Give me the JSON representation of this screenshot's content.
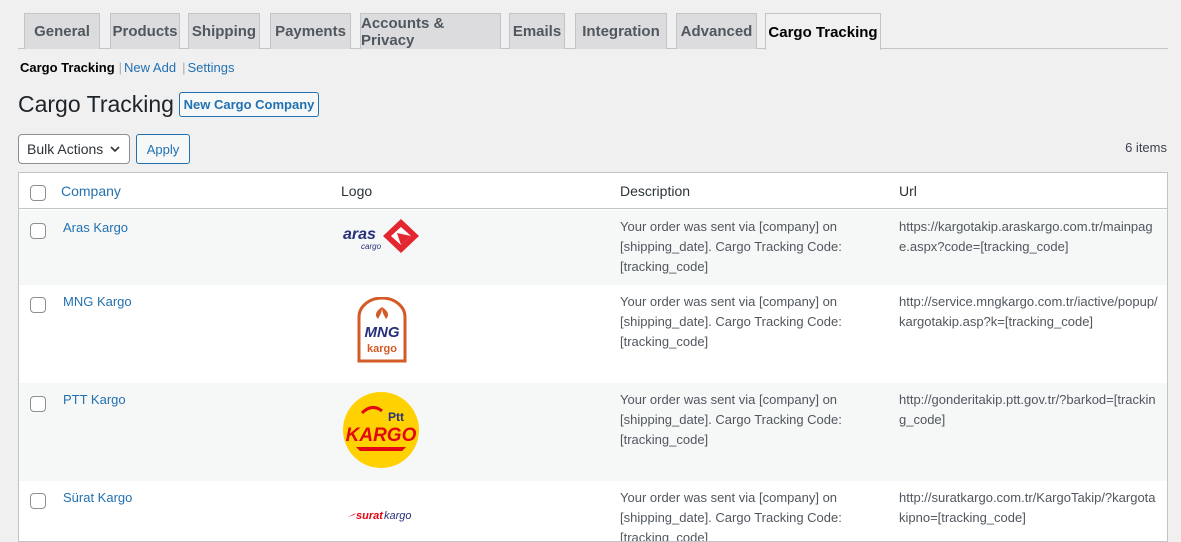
{
  "tabs": [
    {
      "label": "General",
      "active": false
    },
    {
      "label": "Products",
      "active": false
    },
    {
      "label": "Shipping",
      "active": false
    },
    {
      "label": "Payments",
      "active": false
    },
    {
      "label": "Accounts & Privacy",
      "active": false
    },
    {
      "label": "Emails",
      "active": false
    },
    {
      "label": "Integration",
      "active": false
    },
    {
      "label": "Advanced",
      "active": false
    },
    {
      "label": "Cargo Tracking",
      "active": true
    }
  ],
  "subnav": {
    "current": "Cargo Tracking",
    "new_add": "New Add",
    "settings": "Settings",
    "separator": "|"
  },
  "page": {
    "title": "Cargo Tracking",
    "new_button": "New Cargo Company"
  },
  "tablenav": {
    "bulk_actions": "Bulk Actions",
    "apply": "Apply",
    "items_count": "6 items"
  },
  "table": {
    "headers": {
      "company": "Company",
      "logo": "Logo",
      "description": "Description",
      "url": "Url"
    },
    "rows": [
      {
        "company": "Aras Kargo",
        "logo": {
          "word1": "aras",
          "word2": "cargo"
        },
        "description": "Your order was sent via [company] on [shipping_date]. Cargo Tracking Code: [tracking_code]",
        "url": "https://kargotakip.araskargo.com.tr/mainpage.aspx?code=[tracking_code]"
      },
      {
        "company": "MNG Kargo",
        "logo": {
          "word1": "MNG",
          "word2": "kargo"
        },
        "description": "Your order was sent via [company] on [shipping_date]. Cargo Tracking Code: [tracking_code]",
        "url": "http://service.mngkargo.com.tr/iactive/popup/kargotakip.asp?k=[tracking_code]"
      },
      {
        "company": "PTT Kargo",
        "logo": {
          "word1": "Ptt",
          "word2": "KARGO"
        },
        "description": "Your order was sent via [company] on [shipping_date]. Cargo Tracking Code: [tracking_code]",
        "url": "http://gonderitakip.ptt.gov.tr/?barkod=[tracking_code]"
      },
      {
        "company": "Sürat Kargo",
        "logo": {
          "word1": "surat",
          "word2": "kargo"
        },
        "description": "Your order was sent via [company] on [shipping_date]. Cargo Tracking Code: [tracking_code]",
        "url": "http://suratkargo.com.tr/KargoTakip/?kargotakipno=[tracking_code]"
      }
    ]
  },
  "colors": {
    "link": "#2271b1",
    "aras_red": "#e3262f",
    "mng_orange": "#d35b28",
    "mng_navy": "#27307a",
    "ptt_yellow": "#ffd100",
    "ptt_red": "#e30613"
  }
}
